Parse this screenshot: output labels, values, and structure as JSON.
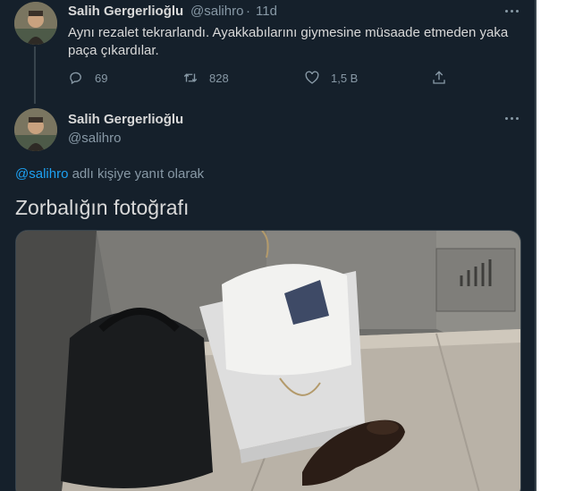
{
  "tweet1": {
    "author_name": "Salih Gergerlioğlu",
    "handle": "@salihro",
    "separator": "·",
    "time": "11d",
    "text": "Aynı rezalet tekrarlandı. Ayakkabılarını giymesine müsaade etmeden yaka paça çıkardılar.",
    "actions": {
      "reply_count": "69",
      "retweet_count": "828",
      "like_count": "1,5 B"
    }
  },
  "tweet2": {
    "author_name": "Salih Gergerlioğlu",
    "handle": "@salihro",
    "reply_mention": "@salihro",
    "reply_suffix": " adlı kişiye yanıt olarak",
    "text": "Zorbalığın fotoğrafı"
  },
  "colors": {
    "background": "#15202b",
    "text": "#d9d9d9",
    "muted": "#8899a6",
    "accent": "#1da1f2",
    "border": "#38444d"
  },
  "icons": [
    "more-icon",
    "reply-icon",
    "retweet-icon",
    "like-icon",
    "share-icon"
  ]
}
